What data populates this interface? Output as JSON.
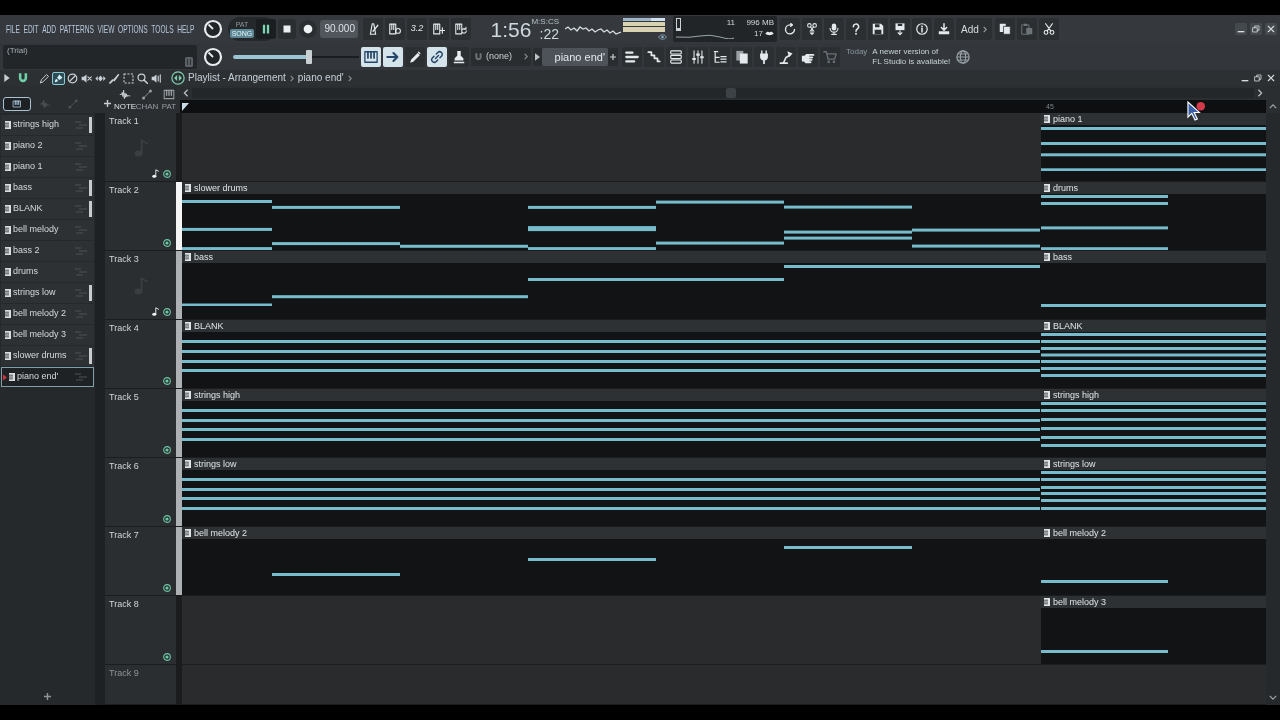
{
  "menu": {
    "items": [
      "FILE",
      "EDIT",
      "ADD",
      "PATTERNS",
      "VIEW",
      "OPTIONS",
      "TOOLS",
      "HELP"
    ]
  },
  "transport": {
    "modes": [
      {
        "label": "PAT",
        "selected": false
      },
      {
        "label": "SONG",
        "selected": true
      }
    ],
    "playing": true,
    "tempo": "90.000"
  },
  "toolbar": {
    "countdown": "3.2",
    "add_label": "Add"
  },
  "time_display": {
    "value": "1:56",
    "fraction": ":22",
    "format": "M:S:CS"
  },
  "system_monitor": {
    "cpu": "11",
    "memory": "996 MB",
    "polyphony": "17"
  },
  "hint_bar": {
    "text": "(Trial)"
  },
  "master_slider": {
    "level": 0.6
  },
  "tool_toggles": [
    {
      "on": true
    },
    {
      "on": true
    },
    {
      "on": false
    },
    {
      "on": true
    },
    {
      "on": false
    }
  ],
  "snap": {
    "value": "(none)"
  },
  "pattern_selector": {
    "value": "piano end'"
  },
  "news": {
    "date": "Today",
    "message": "A newer version of\nFL Studio is available!"
  },
  "playlist": {
    "title": "Playlist - Arrangement",
    "breadcrumb": "piano end'",
    "tools": [
      {
        "selected": false
      },
      {
        "selected": true
      },
      {
        "selected": false
      },
      {
        "selected": false
      },
      {
        "selected": false
      },
      {
        "selected": false
      },
      {
        "selected": false
      },
      {
        "selected": false
      },
      {
        "selected": false
      }
    ],
    "picker_tabs": [
      {
        "selected": true
      },
      {
        "selected": false
      },
      {
        "selected": false
      }
    ],
    "clip_sources": [
      {
        "label": "NOTE",
        "on": true
      },
      {
        "label": "CHAN",
        "on": false
      },
      {
        "label": "PAT",
        "on": false
      }
    ],
    "marker": "45",
    "patterns": [
      {
        "name": "strings high",
        "selected": false,
        "marked": true
      },
      {
        "name": "piano 2",
        "selected": false,
        "marked": false
      },
      {
        "name": "piano 1",
        "selected": false,
        "marked": false
      },
      {
        "name": "bass",
        "selected": false,
        "marked": true
      },
      {
        "name": "BLANK",
        "selected": false,
        "marked": true
      },
      {
        "name": "bell melody",
        "selected": false,
        "marked": false
      },
      {
        "name": "bass 2",
        "selected": false,
        "marked": false
      },
      {
        "name": "drums",
        "selected": false,
        "marked": false
      },
      {
        "name": "strings low",
        "selected": false,
        "marked": true
      },
      {
        "name": "bell melody 2",
        "selected": false,
        "marked": false
      },
      {
        "name": "bell melody 3",
        "selected": false,
        "marked": false
      },
      {
        "name": "slower drums",
        "selected": false,
        "marked": true
      },
      {
        "name": "piano end'",
        "selected": true,
        "marked": false
      }
    ],
    "tracks": [
      {
        "name": "Track 1",
        "dimmed": false,
        "selected": false,
        "marked": false,
        "note_mark": true,
        "on": true,
        "clips": [
          {
            "label": "piano 1",
            "starts_at_marker": true
          }
        ]
      },
      {
        "name": "Track 2",
        "dimmed": false,
        "selected": true,
        "note_mark": false,
        "on": true,
        "clips": [
          {
            "label": "slower drums",
            "starts_at_marker": false
          },
          {
            "label": "drums",
            "starts_at_marker": true
          }
        ]
      },
      {
        "name": "Track 3",
        "dimmed": false,
        "selected": false,
        "marked": true,
        "note_mark": true,
        "on": true,
        "clips": [
          {
            "label": "bass",
            "starts_at_marker": false
          },
          {
            "label": "bass",
            "starts_at_marker": true
          }
        ]
      },
      {
        "name": "Track 4",
        "dimmed": false,
        "selected": false,
        "marked": true,
        "note_mark": false,
        "on": true,
        "clips": [
          {
            "label": "BLANK",
            "starts_at_marker": false
          },
          {
            "label": "BLANK",
            "starts_at_marker": true
          }
        ]
      },
      {
        "name": "Track 5",
        "dimmed": false,
        "selected": false,
        "marked": true,
        "note_mark": false,
        "on": true,
        "clips": [
          {
            "label": "strings high",
            "starts_at_marker": false
          },
          {
            "label": "strings high",
            "starts_at_marker": true
          }
        ]
      },
      {
        "name": "Track 6",
        "dimmed": false,
        "selected": false,
        "marked": true,
        "note_mark": false,
        "on": true,
        "clips": [
          {
            "label": "strings low",
            "starts_at_marker": false
          },
          {
            "label": "strings low",
            "starts_at_marker": true
          }
        ]
      },
      {
        "name": "Track 7",
        "dimmed": false,
        "selected": false,
        "marked": true,
        "note_mark": false,
        "on": true,
        "clips": [
          {
            "label": "bell melody 2",
            "starts_at_marker": false
          },
          {
            "label": "bell melody 2",
            "starts_at_marker": true
          }
        ]
      },
      {
        "name": "Track 8",
        "dimmed": false,
        "selected": false,
        "marked": false,
        "note_mark": false,
        "on": true,
        "clips": [
          {
            "label": "bell melody 3",
            "starts_at_marker": true
          }
        ]
      },
      {
        "name": "Track 9",
        "dimmed": true,
        "selected": false,
        "marked": false
      }
    ]
  }
}
